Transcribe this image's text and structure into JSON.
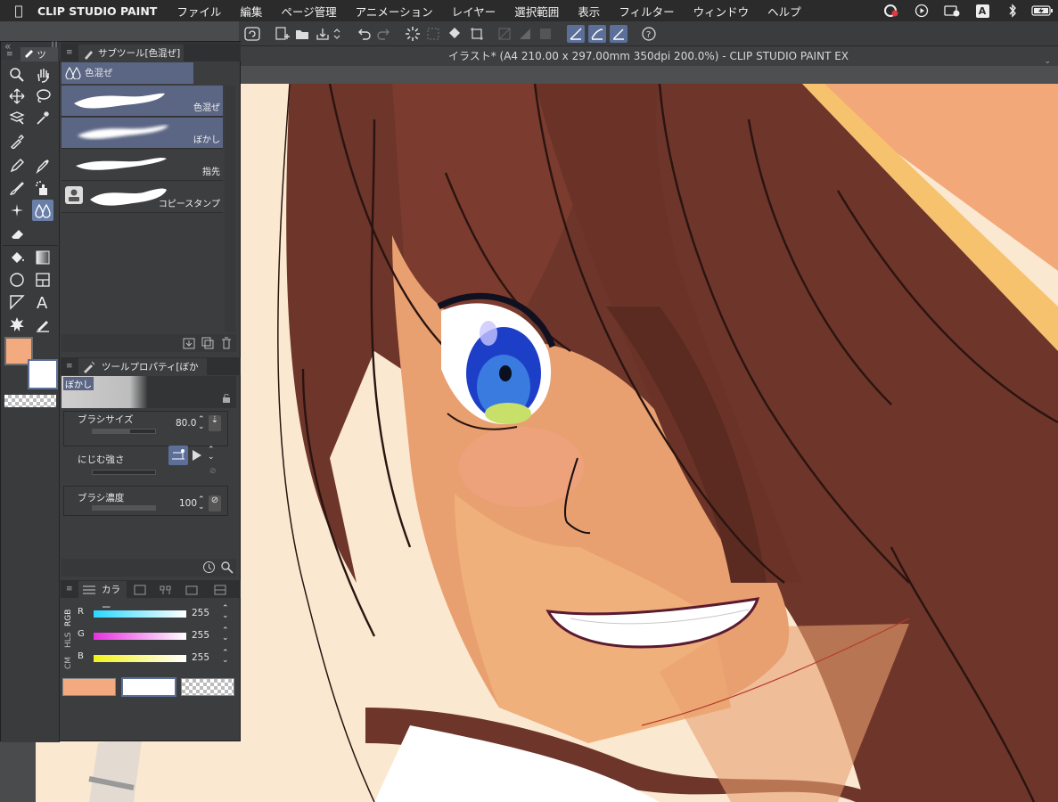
{
  "menubar": {
    "app_name": "CLIP STUDIO PAINT",
    "items": [
      "ファイル",
      "編集",
      "ページ管理",
      "アニメーション",
      "レイヤー",
      "選択範囲",
      "表示",
      "フィルター",
      "ウィンドウ",
      "ヘルプ"
    ],
    "tray_a": "A"
  },
  "window": {
    "title": "イラスト* (A4 210.00 x 297.00mm 350dpi 200.0%)  - CLIP STUDIO PAINT EX"
  },
  "subtool": {
    "header": "サブツール[色混ぜ]",
    "group_tab": "色混ぜ",
    "items": [
      {
        "label": "色混ぜ"
      },
      {
        "label": "ぼかし"
      },
      {
        "label": "指先"
      },
      {
        "label": "コピースタンプ"
      }
    ],
    "tool_tab": "ツ"
  },
  "tool_property": {
    "header": "ツールプロパティ[ぼかし]",
    "preview_label": "ぼかし",
    "brush_size_label": "ブラシサイズ",
    "brush_size_value": "80.0",
    "blend_label": "にじむ強さ",
    "density_label": "ブラシ濃度",
    "density_value": "100"
  },
  "color_panel": {
    "tab_label": "カラー",
    "modes": [
      "RGB",
      "HLS",
      "CM"
    ],
    "channels": [
      {
        "label": "R",
        "value": "255"
      },
      {
        "label": "G",
        "value": "255"
      },
      {
        "label": "B",
        "value": "255"
      }
    ]
  },
  "colors": {
    "main": "#f4aa7f",
    "sub": "#ffffff",
    "accent": "#5c6f98"
  },
  "icons": [
    "zoom-icon",
    "hand-icon",
    "move-icon",
    "lasso-icon",
    "select-layer-icon",
    "magic-wand-icon",
    "eyedropper-icon",
    "pen-icon",
    "pencil-icon",
    "brush-icon",
    "airbrush-icon",
    "decoration-icon",
    "blend-icon",
    "eraser-icon",
    "fill-icon",
    "gradient-icon",
    "figure-icon",
    "frame-icon",
    "text-icon",
    "balloon-icon",
    "ruler-icon",
    "correction-line-icon"
  ]
}
